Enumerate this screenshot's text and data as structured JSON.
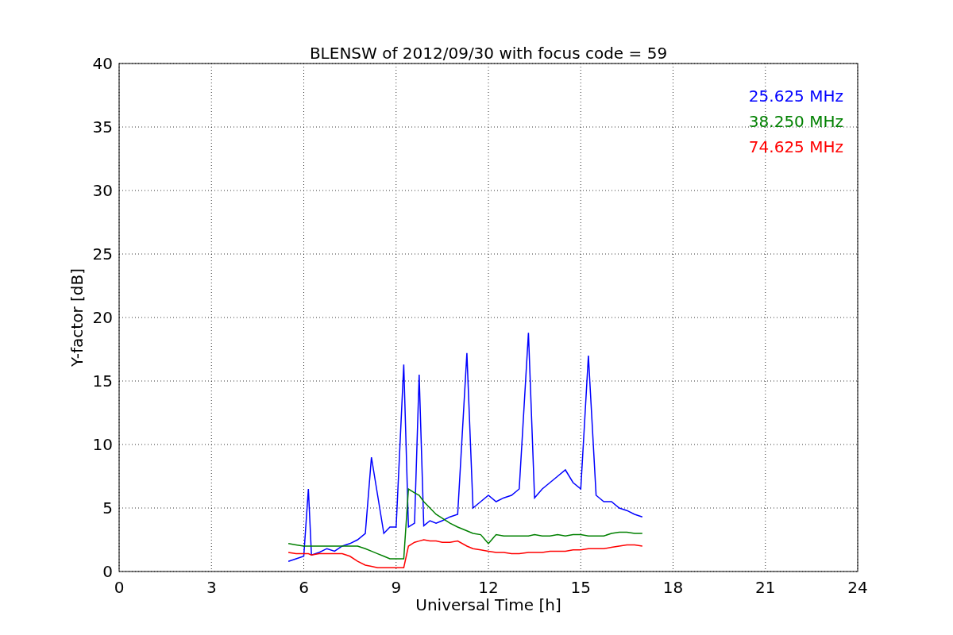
{
  "chart_data": {
    "type": "line",
    "title": "BLENSW of 2012/09/30 with focus code = 59",
    "xlabel": "Universal Time [h]",
    "ylabel": "Y-factor [dB]",
    "x": [
      5.5,
      5.75,
      6.0,
      6.15,
      6.25,
      6.5,
      6.75,
      7.0,
      7.25,
      7.5,
      7.75,
      8.0,
      8.2,
      8.4,
      8.6,
      8.8,
      9.0,
      9.25,
      9.4,
      9.6,
      9.75,
      9.9,
      10.1,
      10.3,
      10.5,
      10.75,
      11.0,
      11.3,
      11.5,
      11.75,
      12.0,
      12.25,
      12.5,
      12.75,
      13.0,
      13.3,
      13.5,
      13.75,
      14.0,
      14.25,
      14.5,
      14.75,
      15.0,
      15.25,
      15.5,
      15.75,
      16.0,
      16.25,
      16.5,
      16.75,
      17.0
    ],
    "series": [
      {
        "name": "25.625 MHz",
        "color": "#0000ff",
        "values": [
          0.8,
          1.0,
          1.2,
          6.5,
          1.3,
          1.5,
          1.8,
          1.6,
          2.0,
          2.2,
          2.5,
          3.0,
          9.0,
          6.0,
          3.0,
          3.5,
          3.5,
          16.3,
          3.5,
          3.8,
          15.5,
          3.6,
          4.0,
          3.8,
          4.0,
          4.3,
          4.5,
          17.2,
          5.0,
          5.5,
          6.0,
          5.5,
          5.8,
          6.0,
          6.5,
          18.8,
          5.8,
          6.5,
          7.0,
          7.5,
          8.0,
          7.0,
          6.5,
          17.0,
          6.0,
          5.5,
          5.5,
          5.0,
          4.8,
          4.5,
          4.3
        ]
      },
      {
        "name": "38.250 MHz",
        "color": "#008000",
        "values": [
          2.2,
          2.1,
          2.0,
          2.0,
          2.0,
          2.0,
          2.0,
          2.0,
          2.0,
          2.0,
          2.0,
          1.8,
          1.6,
          1.4,
          1.2,
          1.0,
          1.0,
          1.0,
          6.5,
          6.2,
          6.0,
          5.5,
          5.0,
          4.5,
          4.2,
          3.8,
          3.5,
          3.2,
          3.0,
          2.9,
          2.2,
          2.9,
          2.8,
          2.8,
          2.8,
          2.8,
          2.9,
          2.8,
          2.8,
          2.9,
          2.8,
          2.9,
          2.9,
          2.8,
          2.8,
          2.8,
          3.0,
          3.1,
          3.1,
          3.0,
          3.0
        ]
      },
      {
        "name": "74.625 MHz",
        "color": "#ff0000",
        "values": [
          1.5,
          1.4,
          1.4,
          1.4,
          1.3,
          1.4,
          1.4,
          1.4,
          1.4,
          1.2,
          0.8,
          0.5,
          0.4,
          0.3,
          0.3,
          0.3,
          0.3,
          0.3,
          2.0,
          2.3,
          2.4,
          2.5,
          2.4,
          2.4,
          2.3,
          2.3,
          2.4,
          2.0,
          1.8,
          1.7,
          1.6,
          1.5,
          1.5,
          1.4,
          1.4,
          1.5,
          1.5,
          1.5,
          1.6,
          1.6,
          1.6,
          1.7,
          1.7,
          1.8,
          1.8,
          1.8,
          1.9,
          2.0,
          2.1,
          2.1,
          2.0
        ]
      }
    ],
    "xlim": [
      0,
      24
    ],
    "ylim": [
      0,
      40
    ],
    "xticks": [
      0,
      3,
      6,
      9,
      12,
      15,
      18,
      21,
      24
    ],
    "yticks": [
      0,
      5,
      10,
      15,
      20,
      25,
      30,
      35,
      40
    ],
    "grid": true
  }
}
